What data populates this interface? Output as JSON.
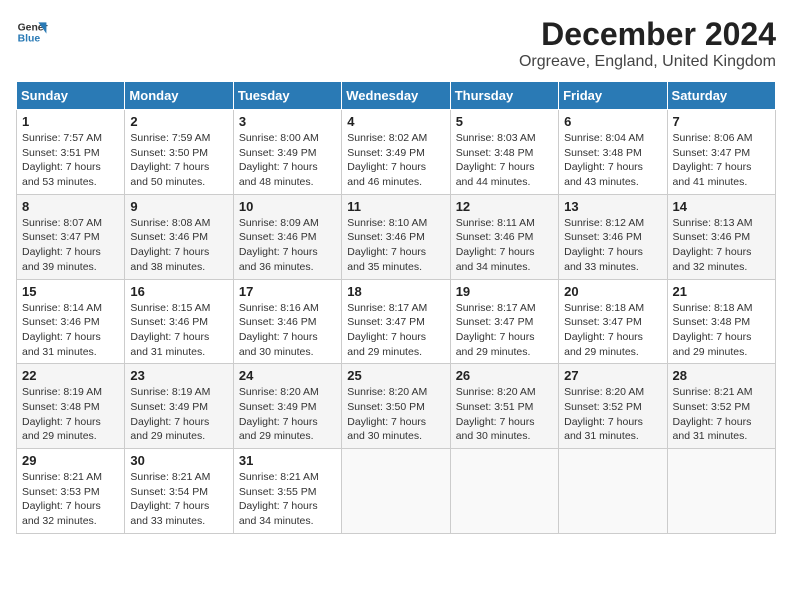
{
  "header": {
    "logo_line1": "General",
    "logo_line2": "Blue",
    "title": "December 2024",
    "subtitle": "Orgreave, England, United Kingdom"
  },
  "columns": [
    "Sunday",
    "Monday",
    "Tuesday",
    "Wednesday",
    "Thursday",
    "Friday",
    "Saturday"
  ],
  "weeks": [
    [
      {
        "day": "1",
        "sunrise": "Sunrise: 7:57 AM",
        "sunset": "Sunset: 3:51 PM",
        "daylight": "Daylight: 7 hours and 53 minutes."
      },
      {
        "day": "2",
        "sunrise": "Sunrise: 7:59 AM",
        "sunset": "Sunset: 3:50 PM",
        "daylight": "Daylight: 7 hours and 50 minutes."
      },
      {
        "day": "3",
        "sunrise": "Sunrise: 8:00 AM",
        "sunset": "Sunset: 3:49 PM",
        "daylight": "Daylight: 7 hours and 48 minutes."
      },
      {
        "day": "4",
        "sunrise": "Sunrise: 8:02 AM",
        "sunset": "Sunset: 3:49 PM",
        "daylight": "Daylight: 7 hours and 46 minutes."
      },
      {
        "day": "5",
        "sunrise": "Sunrise: 8:03 AM",
        "sunset": "Sunset: 3:48 PM",
        "daylight": "Daylight: 7 hours and 44 minutes."
      },
      {
        "day": "6",
        "sunrise": "Sunrise: 8:04 AM",
        "sunset": "Sunset: 3:48 PM",
        "daylight": "Daylight: 7 hours and 43 minutes."
      },
      {
        "day": "7",
        "sunrise": "Sunrise: 8:06 AM",
        "sunset": "Sunset: 3:47 PM",
        "daylight": "Daylight: 7 hours and 41 minutes."
      }
    ],
    [
      {
        "day": "8",
        "sunrise": "Sunrise: 8:07 AM",
        "sunset": "Sunset: 3:47 PM",
        "daylight": "Daylight: 7 hours and 39 minutes."
      },
      {
        "day": "9",
        "sunrise": "Sunrise: 8:08 AM",
        "sunset": "Sunset: 3:46 PM",
        "daylight": "Daylight: 7 hours and 38 minutes."
      },
      {
        "day": "10",
        "sunrise": "Sunrise: 8:09 AM",
        "sunset": "Sunset: 3:46 PM",
        "daylight": "Daylight: 7 hours and 36 minutes."
      },
      {
        "day": "11",
        "sunrise": "Sunrise: 8:10 AM",
        "sunset": "Sunset: 3:46 PM",
        "daylight": "Daylight: 7 hours and 35 minutes."
      },
      {
        "day": "12",
        "sunrise": "Sunrise: 8:11 AM",
        "sunset": "Sunset: 3:46 PM",
        "daylight": "Daylight: 7 hours and 34 minutes."
      },
      {
        "day": "13",
        "sunrise": "Sunrise: 8:12 AM",
        "sunset": "Sunset: 3:46 PM",
        "daylight": "Daylight: 7 hours and 33 minutes."
      },
      {
        "day": "14",
        "sunrise": "Sunrise: 8:13 AM",
        "sunset": "Sunset: 3:46 PM",
        "daylight": "Daylight: 7 hours and 32 minutes."
      }
    ],
    [
      {
        "day": "15",
        "sunrise": "Sunrise: 8:14 AM",
        "sunset": "Sunset: 3:46 PM",
        "daylight": "Daylight: 7 hours and 31 minutes."
      },
      {
        "day": "16",
        "sunrise": "Sunrise: 8:15 AM",
        "sunset": "Sunset: 3:46 PM",
        "daylight": "Daylight: 7 hours and 31 minutes."
      },
      {
        "day": "17",
        "sunrise": "Sunrise: 8:16 AM",
        "sunset": "Sunset: 3:46 PM",
        "daylight": "Daylight: 7 hours and 30 minutes."
      },
      {
        "day": "18",
        "sunrise": "Sunrise: 8:17 AM",
        "sunset": "Sunset: 3:47 PM",
        "daylight": "Daylight: 7 hours and 29 minutes."
      },
      {
        "day": "19",
        "sunrise": "Sunrise: 8:17 AM",
        "sunset": "Sunset: 3:47 PM",
        "daylight": "Daylight: 7 hours and 29 minutes."
      },
      {
        "day": "20",
        "sunrise": "Sunrise: 8:18 AM",
        "sunset": "Sunset: 3:47 PM",
        "daylight": "Daylight: 7 hours and 29 minutes."
      },
      {
        "day": "21",
        "sunrise": "Sunrise: 8:18 AM",
        "sunset": "Sunset: 3:48 PM",
        "daylight": "Daylight: 7 hours and 29 minutes."
      }
    ],
    [
      {
        "day": "22",
        "sunrise": "Sunrise: 8:19 AM",
        "sunset": "Sunset: 3:48 PM",
        "daylight": "Daylight: 7 hours and 29 minutes."
      },
      {
        "day": "23",
        "sunrise": "Sunrise: 8:19 AM",
        "sunset": "Sunset: 3:49 PM",
        "daylight": "Daylight: 7 hours and 29 minutes."
      },
      {
        "day": "24",
        "sunrise": "Sunrise: 8:20 AM",
        "sunset": "Sunset: 3:49 PM",
        "daylight": "Daylight: 7 hours and 29 minutes."
      },
      {
        "day": "25",
        "sunrise": "Sunrise: 8:20 AM",
        "sunset": "Sunset: 3:50 PM",
        "daylight": "Daylight: 7 hours and 30 minutes."
      },
      {
        "day": "26",
        "sunrise": "Sunrise: 8:20 AM",
        "sunset": "Sunset: 3:51 PM",
        "daylight": "Daylight: 7 hours and 30 minutes."
      },
      {
        "day": "27",
        "sunrise": "Sunrise: 8:20 AM",
        "sunset": "Sunset: 3:52 PM",
        "daylight": "Daylight: 7 hours and 31 minutes."
      },
      {
        "day": "28",
        "sunrise": "Sunrise: 8:21 AM",
        "sunset": "Sunset: 3:52 PM",
        "daylight": "Daylight: 7 hours and 31 minutes."
      }
    ],
    [
      {
        "day": "29",
        "sunrise": "Sunrise: 8:21 AM",
        "sunset": "Sunset: 3:53 PM",
        "daylight": "Daylight: 7 hours and 32 minutes."
      },
      {
        "day": "30",
        "sunrise": "Sunrise: 8:21 AM",
        "sunset": "Sunset: 3:54 PM",
        "daylight": "Daylight: 7 hours and 33 minutes."
      },
      {
        "day": "31",
        "sunrise": "Sunrise: 8:21 AM",
        "sunset": "Sunset: 3:55 PM",
        "daylight": "Daylight: 7 hours and 34 minutes."
      },
      null,
      null,
      null,
      null
    ]
  ]
}
